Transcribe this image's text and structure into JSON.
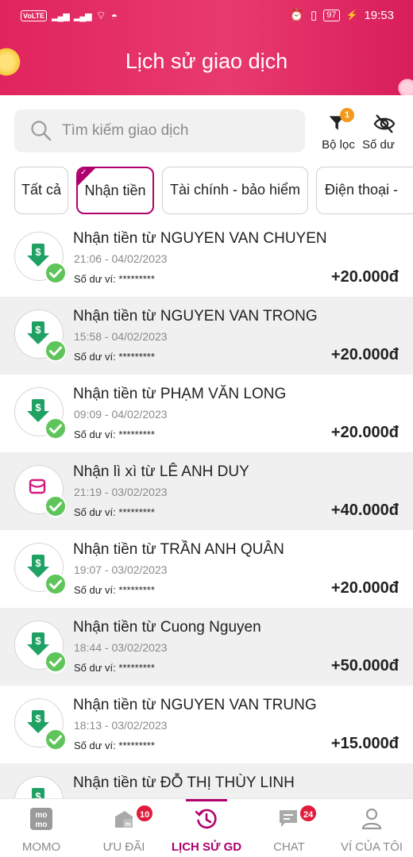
{
  "status_bar": {
    "time": "19:53",
    "battery": "97",
    "volte": "VoLTE"
  },
  "header": {
    "title": "Lịch sử giao dịch"
  },
  "search": {
    "placeholder": "Tìm kiếm giao dịch"
  },
  "tools": {
    "filter": {
      "label": "Bộ lọc",
      "badge": "1"
    },
    "balance": {
      "label": "Số dư"
    }
  },
  "chips": [
    {
      "label": "Tất cả"
    },
    {
      "label": "Nhận tiền"
    },
    {
      "label": "Tài chính - bảo hiểm"
    },
    {
      "label": "Điện thoại -"
    }
  ],
  "transactions": [
    {
      "title": "Nhận tiền từ NGUYEN VAN CHUYEN",
      "time": "21:06 - 04/02/2023",
      "balance": "Số dư ví: *********",
      "amount": "+20.000đ",
      "icon": "money-receive-icon"
    },
    {
      "title": "Nhận tiền từ NGUYEN VAN TRONG",
      "time": "15:58 - 04/02/2023",
      "balance": "Số dư ví: *********",
      "amount": "+20.000đ",
      "icon": "money-receive-icon"
    },
    {
      "title": "Nhận tiền từ PHẠM VĂN LONG",
      "time": "09:09 - 04/02/2023",
      "balance": "Số dư ví: *********",
      "amount": "+20.000đ",
      "icon": "money-receive-icon"
    },
    {
      "title": "Nhận lì xì từ LÊ ANH DUY",
      "time": "21:19 - 03/02/2023",
      "balance": "Số dư ví: *********",
      "amount": "+40.000đ",
      "icon": "lixi-envelope-icon"
    },
    {
      "title": "Nhận tiền từ TRẦN ANH QUÂN",
      "time": "19:07 - 03/02/2023",
      "balance": "Số dư ví: *********",
      "amount": "+20.000đ",
      "icon": "money-receive-icon"
    },
    {
      "title": "Nhận tiền từ Cuong Nguyen",
      "time": "18:44 - 03/02/2023",
      "balance": "Số dư ví: *********",
      "amount": "+50.000đ",
      "icon": "money-receive-icon"
    },
    {
      "title": "Nhận tiền từ NGUYEN VAN TRUNG",
      "time": "18:13 - 03/02/2023",
      "balance": "Số dư ví: *********",
      "amount": "+15.000đ",
      "icon": "money-receive-icon"
    },
    {
      "title": "Nhận tiền từ ĐỖ THỊ THÙY LINH",
      "time": "",
      "balance": "",
      "amount": "",
      "icon": "money-receive-icon"
    }
  ],
  "bottom_nav": [
    {
      "label": "MOMO",
      "icon": "momo-logo-icon"
    },
    {
      "label": "ƯU ĐÃI",
      "icon": "promo-icon",
      "badge": "10"
    },
    {
      "label": "LỊCH SỬ GD",
      "icon": "history-icon"
    },
    {
      "label": "CHAT",
      "icon": "chat-icon",
      "badge": "24"
    },
    {
      "label": "VÍ CỦA TÔI",
      "icon": "user-icon"
    }
  ],
  "colors": {
    "brand": "#b0006d",
    "header": "#e0245e",
    "success": "#5fc55a",
    "money": "#1fa164",
    "badge": "#e11b3c",
    "filter_badge": "#f29a1e"
  }
}
